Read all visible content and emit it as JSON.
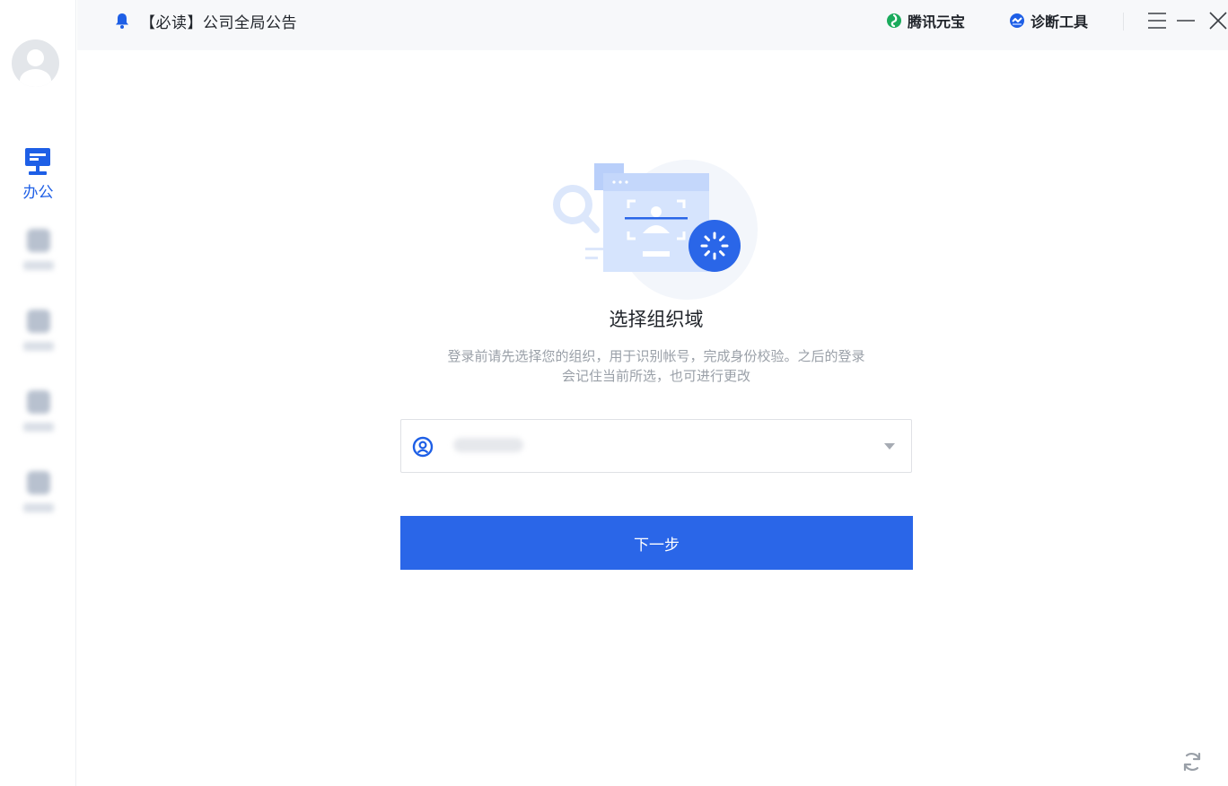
{
  "topbar": {
    "notice": "【必读】公司全局公告",
    "yuanbao": "腾讯元宝",
    "diagnose": "诊断工具"
  },
  "sidebar": {
    "office_label": "办公"
  },
  "main": {
    "title": "选择组织域",
    "description_line1": "登录前请先选择您的组织，用于识别帐号，完成身份校验。之后的登录",
    "description_line2": "会记住当前所选，也可进行更改",
    "next_button": "下一步"
  },
  "colors": {
    "primary": "#2a66e8",
    "yuanbao_green": "#1aab5c"
  },
  "icons": [
    "bell-icon",
    "yuanbao-icon",
    "diagnose-icon",
    "menu-icon",
    "minimize-icon",
    "close-icon",
    "office-icon",
    "user-circle-icon",
    "chevron-down-icon",
    "refresh-icon"
  ]
}
